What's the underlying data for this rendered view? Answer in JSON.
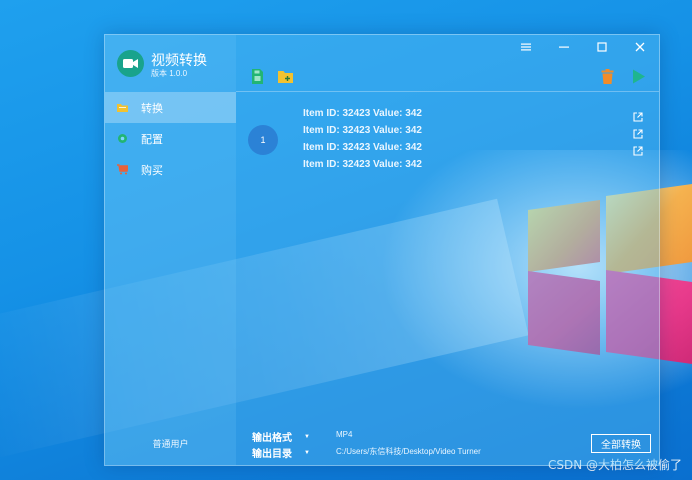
{
  "app": {
    "title": "视频转换",
    "version": "版本 1.0.0",
    "user_label": "普通用户"
  },
  "sidebar": {
    "items": [
      {
        "label": "转换",
        "icon": "folder-icon",
        "color": "#f2c230",
        "active": true
      },
      {
        "label": "配置",
        "icon": "gear-icon",
        "color": "#22b573",
        "active": false
      },
      {
        "label": "购买",
        "icon": "cart-icon",
        "color": "#e8623a",
        "active": false
      }
    ]
  },
  "toolbar": {
    "left": [
      {
        "icon": "save-file-icon",
        "color": "#22b573"
      },
      {
        "icon": "add-folder-icon",
        "color": "#f2c230"
      }
    ],
    "right": [
      {
        "icon": "trash-icon",
        "color": "#f08c2a"
      },
      {
        "icon": "play-icon",
        "color": "#1fb58f"
      }
    ]
  },
  "window_controls": [
    "menu-icon",
    "minimize-icon",
    "maximize-icon",
    "close-icon"
  ],
  "task": {
    "badge": "1",
    "items": [
      {
        "text": "Item ID: 32423 Value: 342"
      },
      {
        "text": "Item ID: 32423 Value: 342"
      },
      {
        "text": "Item ID: 32423 Value: 342"
      },
      {
        "text": "Item ID: 32423 Value: 342"
      }
    ],
    "open_icons": [
      "external-link-icon",
      "external-link-icon",
      "external-link-icon"
    ]
  },
  "output": {
    "format_label": "输出格式",
    "format_value": "MP4",
    "dir_label": "输出目录",
    "dir_value": "C:/Users/东信科技/Desktop/Video Turner",
    "convert_all": "全部转换"
  },
  "watermark": "CSDN @大柏怎么被偷了",
  "colors": {
    "accent_teal": "#19a38c",
    "badge_blue": "#2b82d6"
  }
}
